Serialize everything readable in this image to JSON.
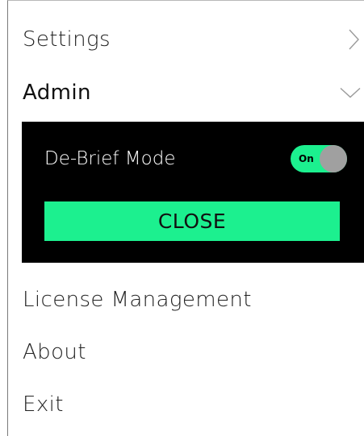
{
  "menu": {
    "settings_label": "Settings",
    "admin_label": "Admin",
    "license_label": "License Management",
    "about_label": "About",
    "exit_label": "Exit"
  },
  "admin_panel": {
    "debrief_label": "De-Brief Mode",
    "toggle_state_label": "On",
    "close_label": "CLOSE"
  },
  "colors": {
    "accent": "#1cf08f",
    "panel_bg": "#000000",
    "knob": "#a0a0a0",
    "chevron": "#9a9a9a"
  },
  "icons": {
    "settings_chevron": "chevron-right-icon",
    "admin_chevron": "chevron-down-icon"
  }
}
